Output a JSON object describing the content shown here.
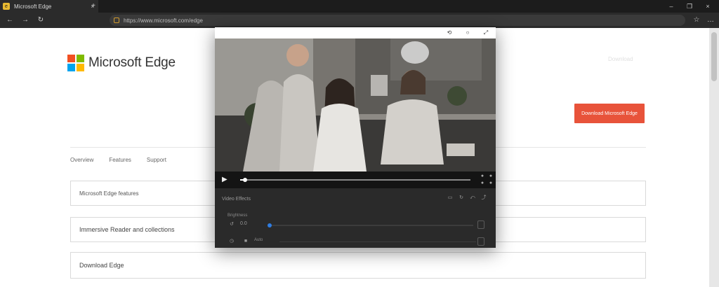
{
  "browser": {
    "tab_title": "Microsoft Edge",
    "tab_close": "×",
    "new_tab": "+",
    "window_controls": [
      "–",
      "❐",
      "×"
    ],
    "back": "←",
    "forward": "→",
    "refresh": "↻",
    "url": "https://www.microsoft.com/edge",
    "toolbar_right": [
      "☆",
      "…"
    ]
  },
  "page": {
    "brand": "Microsoft Edge",
    "top_link": "Download",
    "cta": "Download Microsoft Edge",
    "nav": [
      "Overview",
      "Features",
      "Support"
    ],
    "cards": [
      "Microsoft Edge features",
      "Immersive Reader and collections",
      "Download Edge"
    ]
  },
  "video_window": {
    "titlebar_icons": [
      "⟲",
      "○",
      "⤢"
    ],
    "play_icon": "▶",
    "seek_progress": 0.02,
    "panel_label": "Video Effects",
    "panel_sub": "Brightness",
    "row_value": "0.0",
    "slider_progress": 0.0,
    "row3_text": "Auto",
    "colors": {
      "accent": "#2f7de1",
      "cta": "#e8533a"
    }
  }
}
